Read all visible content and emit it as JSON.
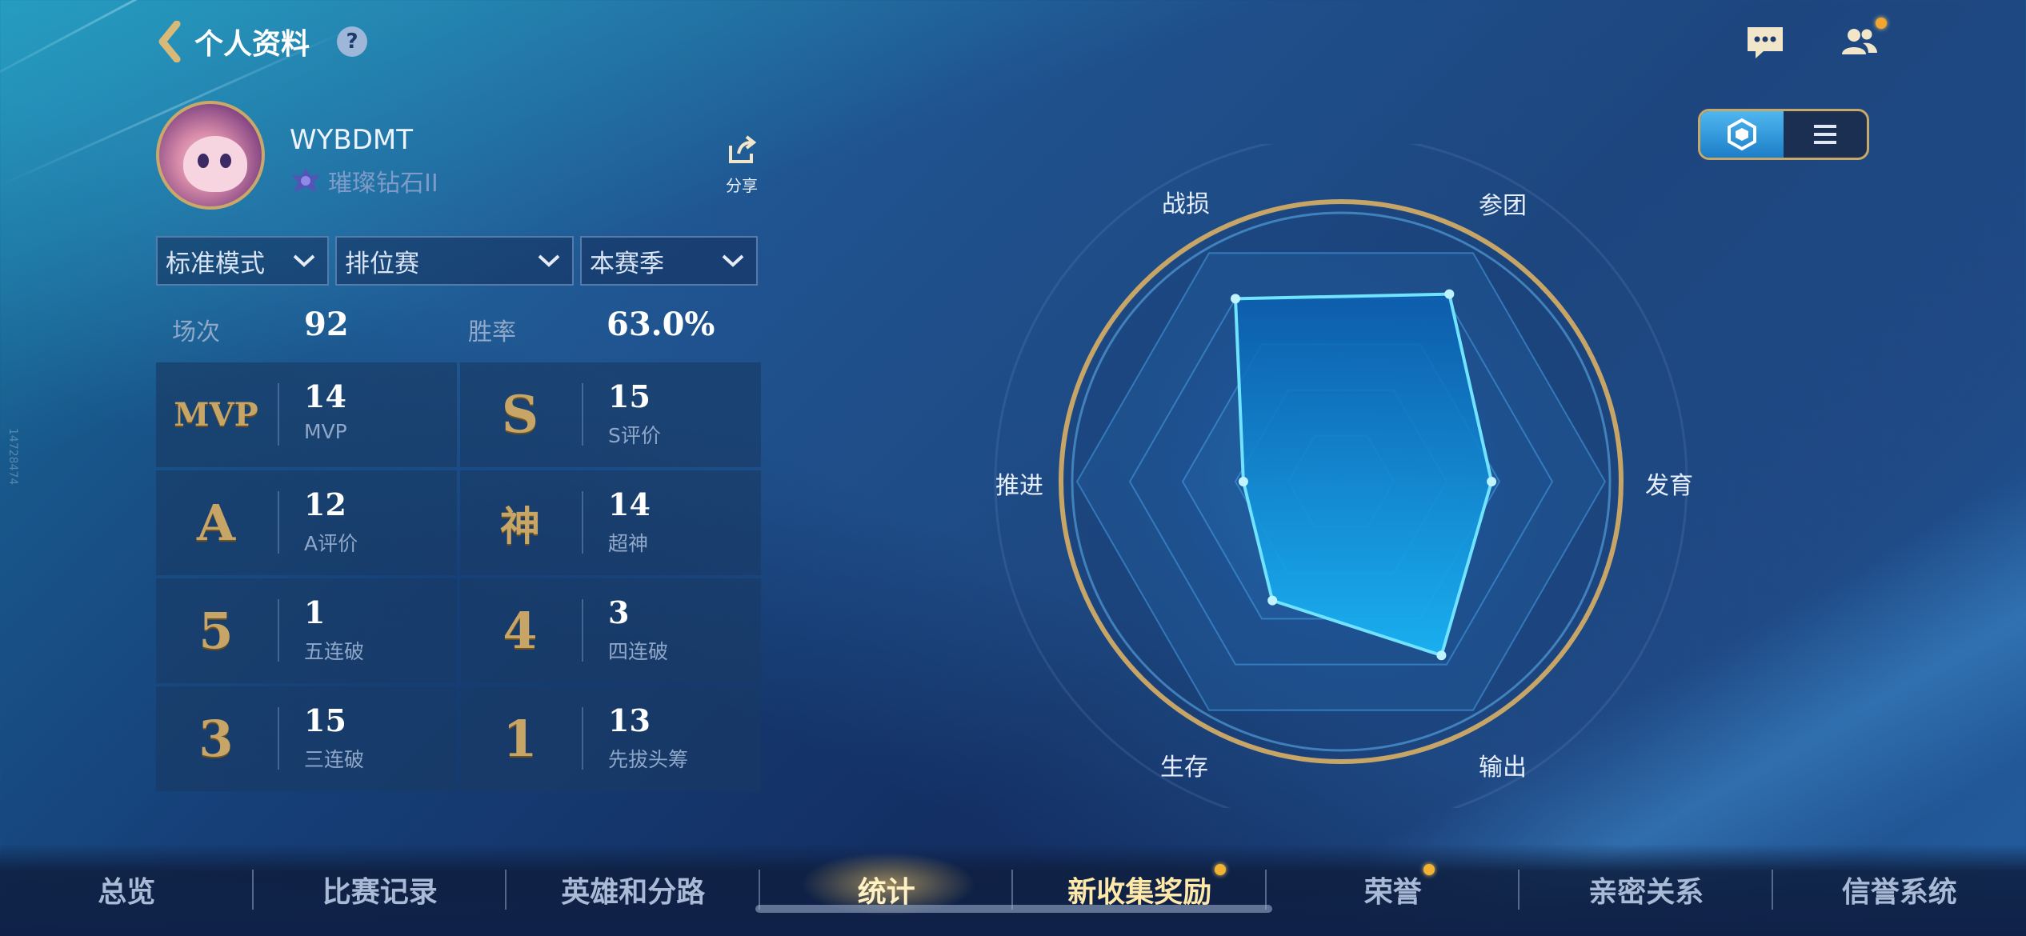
{
  "header": {
    "title": "个人资料",
    "help_icon": "?"
  },
  "top_icons": [
    "chat-icon",
    "friends-icon"
  ],
  "side_id": "14728474",
  "profile": {
    "username": "WYBDMT",
    "rank": "璀璨钻石II",
    "share_label": "分享"
  },
  "filters": [
    {
      "value": "标准模式"
    },
    {
      "value": "排位赛"
    },
    {
      "value": "本赛季"
    }
  ],
  "summary": {
    "games_label": "场次",
    "games_value": "92",
    "winrate_label": "胜率",
    "winrate_value": "63.0%"
  },
  "stats": [
    {
      "icon": "MVP",
      "value": "14",
      "label": "MVP"
    },
    {
      "icon": "S",
      "value": "15",
      "label": "S评价"
    },
    {
      "icon": "A",
      "value": "12",
      "label": "A评价"
    },
    {
      "icon": "神",
      "value": "14",
      "label": "超神"
    },
    {
      "icon": "5",
      "value": "1",
      "label": "五连破"
    },
    {
      "icon": "4",
      "value": "3",
      "label": "四连破"
    },
    {
      "icon": "3",
      "value": "15",
      "label": "三连破"
    },
    {
      "icon": "1",
      "value": "13",
      "label": "先拔头筹"
    }
  ],
  "radar": {
    "axes": [
      "战损",
      "参团",
      "发育",
      "输出",
      "生存",
      "推进"
    ],
    "values": [
      0.8,
      0.82,
      0.57,
      0.76,
      0.52,
      0.37
    ],
    "fill_color": "#19a9f0",
    "stroke_color": "#6fe3ff"
  },
  "view_toggle": {
    "options": [
      "radar-view-icon",
      "list-view-icon"
    ],
    "selected": "radar-view-icon"
  },
  "bottom_nav": {
    "items": [
      "总览",
      "比赛记录",
      "英雄和分路",
      "统计",
      "新收集奖励",
      "荣誉",
      "亲密关系",
      "信誉系统"
    ],
    "active": "统计"
  },
  "colors": {
    "gold": "#c7a567",
    "accent": "#19a9f0",
    "notify": "#f2b232"
  }
}
